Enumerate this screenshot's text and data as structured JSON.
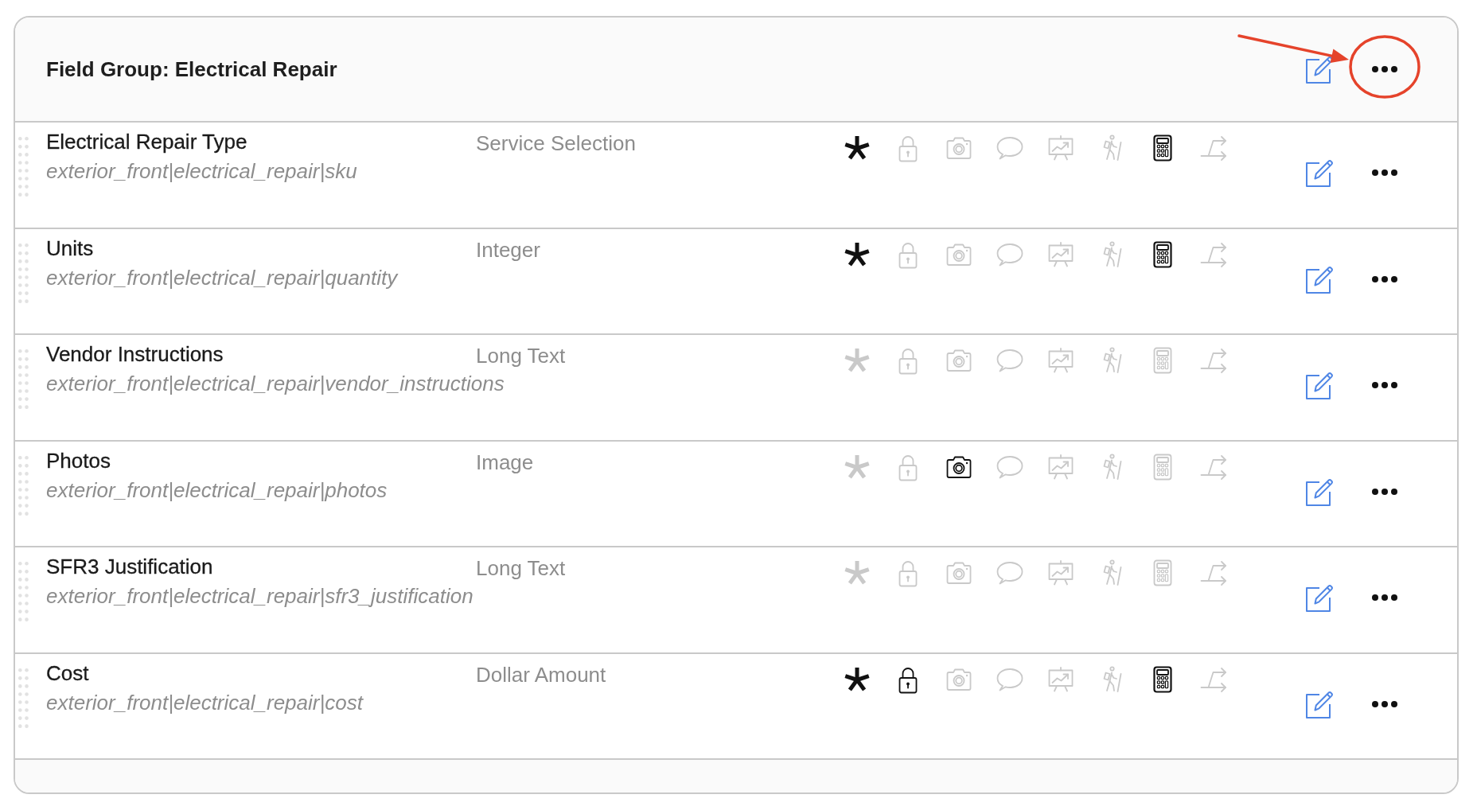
{
  "header": {
    "title": "Field Group: Electrical Repair",
    "menu_highlighted": true
  },
  "rows": [
    {
      "name": "Electrical Repair Type",
      "type": "Service Selection",
      "path": "exterior_front|electrical_repair|sku",
      "flags": [
        {
          "kind": "asterisk",
          "on": true
        },
        {
          "kind": "lock",
          "on": false
        },
        {
          "kind": "camera",
          "on": false
        },
        {
          "kind": "bubble",
          "on": false
        },
        {
          "kind": "chart",
          "on": false
        },
        {
          "kind": "hiker",
          "on": false
        },
        {
          "kind": "calculator",
          "on": true
        },
        {
          "kind": "fork",
          "on": false
        }
      ]
    },
    {
      "name": "Units",
      "type": "Integer",
      "path": "exterior_front|electrical_repair|quantity",
      "flags": [
        {
          "kind": "asterisk",
          "on": true
        },
        {
          "kind": "lock",
          "on": false
        },
        {
          "kind": "camera",
          "on": false
        },
        {
          "kind": "bubble",
          "on": false
        },
        {
          "kind": "chart",
          "on": false
        },
        {
          "kind": "hiker",
          "on": false
        },
        {
          "kind": "calculator",
          "on": true
        },
        {
          "kind": "fork",
          "on": false
        }
      ]
    },
    {
      "name": "Vendor Instructions",
      "type": "Long Text",
      "path": "exterior_front|electrical_repair|vendor_instructions",
      "flags": [
        {
          "kind": "asterisk",
          "on": false
        },
        {
          "kind": "lock",
          "on": false
        },
        {
          "kind": "camera",
          "on": false
        },
        {
          "kind": "bubble",
          "on": false
        },
        {
          "kind": "chart",
          "on": false
        },
        {
          "kind": "hiker",
          "on": false
        },
        {
          "kind": "calculator",
          "on": false
        },
        {
          "kind": "fork",
          "on": false
        }
      ]
    },
    {
      "name": "Photos",
      "type": "Image",
      "path": "exterior_front|electrical_repair|photos",
      "flags": [
        {
          "kind": "asterisk",
          "on": false
        },
        {
          "kind": "lock",
          "on": false
        },
        {
          "kind": "camera",
          "on": true
        },
        {
          "kind": "bubble",
          "on": false
        },
        {
          "kind": "chart",
          "on": false
        },
        {
          "kind": "hiker",
          "on": false
        },
        {
          "kind": "calculator",
          "on": false
        },
        {
          "kind": "fork",
          "on": false
        }
      ]
    },
    {
      "name": "SFR3 Justification",
      "type": "Long Text",
      "path": "exterior_front|electrical_repair|sfr3_justification",
      "flags": [
        {
          "kind": "asterisk",
          "on": false
        },
        {
          "kind": "lock",
          "on": false
        },
        {
          "kind": "camera",
          "on": false
        },
        {
          "kind": "bubble",
          "on": false
        },
        {
          "kind": "chart",
          "on": false
        },
        {
          "kind": "hiker",
          "on": false
        },
        {
          "kind": "calculator",
          "on": false
        },
        {
          "kind": "fork",
          "on": false
        }
      ]
    },
    {
      "name": "Cost",
      "type": "Dollar Amount",
      "path": "exterior_front|electrical_repair|cost",
      "flags": [
        {
          "kind": "asterisk",
          "on": true
        },
        {
          "kind": "lock",
          "on": true
        },
        {
          "kind": "camera",
          "on": false
        },
        {
          "kind": "bubble",
          "on": false
        },
        {
          "kind": "chart",
          "on": false
        },
        {
          "kind": "hiker",
          "on": false
        },
        {
          "kind": "calculator",
          "on": true
        },
        {
          "kind": "fork",
          "on": false
        }
      ]
    }
  ]
}
